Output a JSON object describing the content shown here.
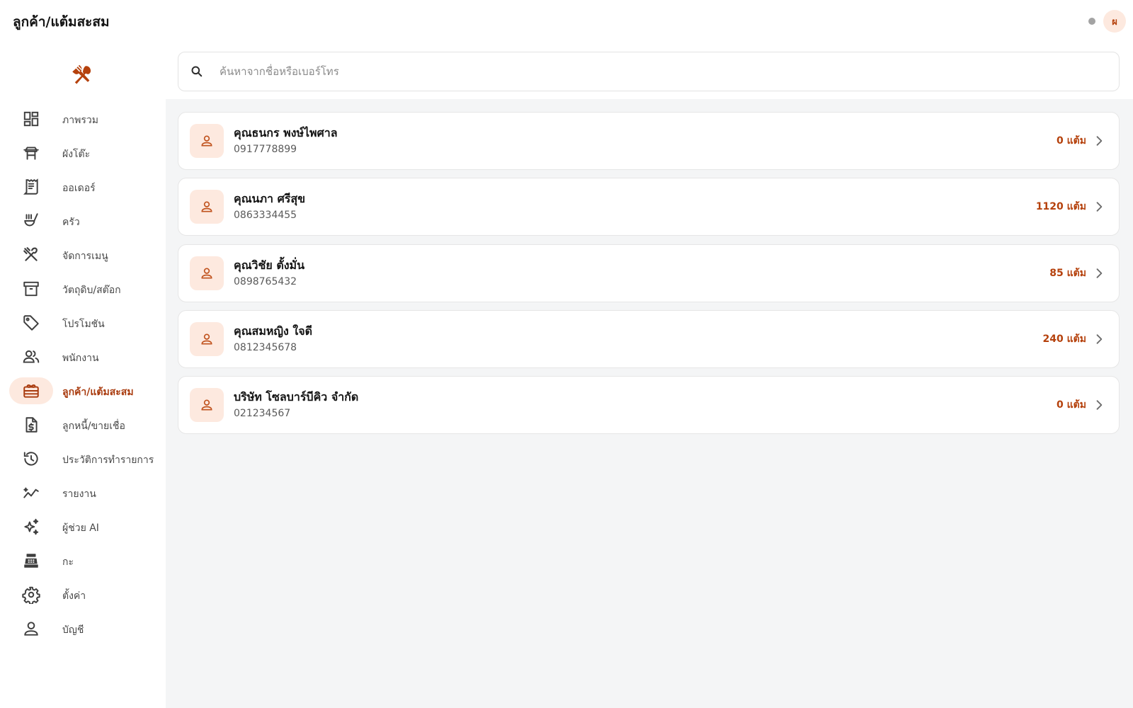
{
  "header": {
    "title": "ลูกค้า/แต้มสะสม",
    "avatar_initial": "ผ"
  },
  "colors": {
    "accent": "#b5410c",
    "accent_bg": "#fde9df",
    "content_bg": "#f4f5f6",
    "status_dot": "#a3a3a3"
  },
  "sidebar": {
    "logo_icon": "fork-spoon-icon",
    "items": [
      {
        "label": "ภาพรวม",
        "icon": "dashboard-icon"
      },
      {
        "label": "ผังโต๊ะ",
        "icon": "table-icon"
      },
      {
        "label": "ออเดอร์",
        "icon": "receipt-icon"
      },
      {
        "label": "ครัว",
        "icon": "kitchen-icon"
      },
      {
        "label": "จัดการเมนู",
        "icon": "utensils-icon"
      },
      {
        "label": "วัตถุดิบ/สต๊อก",
        "icon": "archive-icon"
      },
      {
        "label": "โปรโมชัน",
        "icon": "tag-icon"
      },
      {
        "label": "พนักงาน",
        "icon": "staff-icon"
      },
      {
        "label": "ลูกค้า/แต้มสะสม",
        "icon": "loyalty-icon",
        "active": true
      },
      {
        "label": "ลูกหนี้/ขายเชื่อ",
        "icon": "invoice-dollar-icon"
      },
      {
        "label": "ประวัติการทำรายการ",
        "icon": "history-icon"
      },
      {
        "label": "รายงาน",
        "icon": "trend-icon"
      },
      {
        "label": "ผู้ช่วย AI",
        "icon": "sparkle-icon"
      },
      {
        "label": "กะ",
        "icon": "cash-register-icon"
      },
      {
        "label": "ตั้งค่า",
        "icon": "gear-icon"
      },
      {
        "label": "บัญชี",
        "icon": "person-icon"
      }
    ]
  },
  "search": {
    "placeholder": "ค้นหาจากชื่อหรือเบอร์โทร",
    "value": ""
  },
  "customers": [
    {
      "name": "คุณธนกร พงษ์ไพศาล",
      "phone": "0917778899",
      "points": "0 แต้ม"
    },
    {
      "name": "คุณนภา ศรีสุข",
      "phone": "0863334455",
      "points": "1120 แต้ม"
    },
    {
      "name": "คุณวิชัย ตั้งมั่น",
      "phone": "0898765432",
      "points": "85 แต้ม"
    },
    {
      "name": "คุณสมหญิง ใจดี",
      "phone": "0812345678",
      "points": "240 แต้ม"
    },
    {
      "name": "บริษัท โซลบาร์บีคิว จำกัด",
      "phone": "021234567",
      "points": "0 แต้ม"
    }
  ]
}
